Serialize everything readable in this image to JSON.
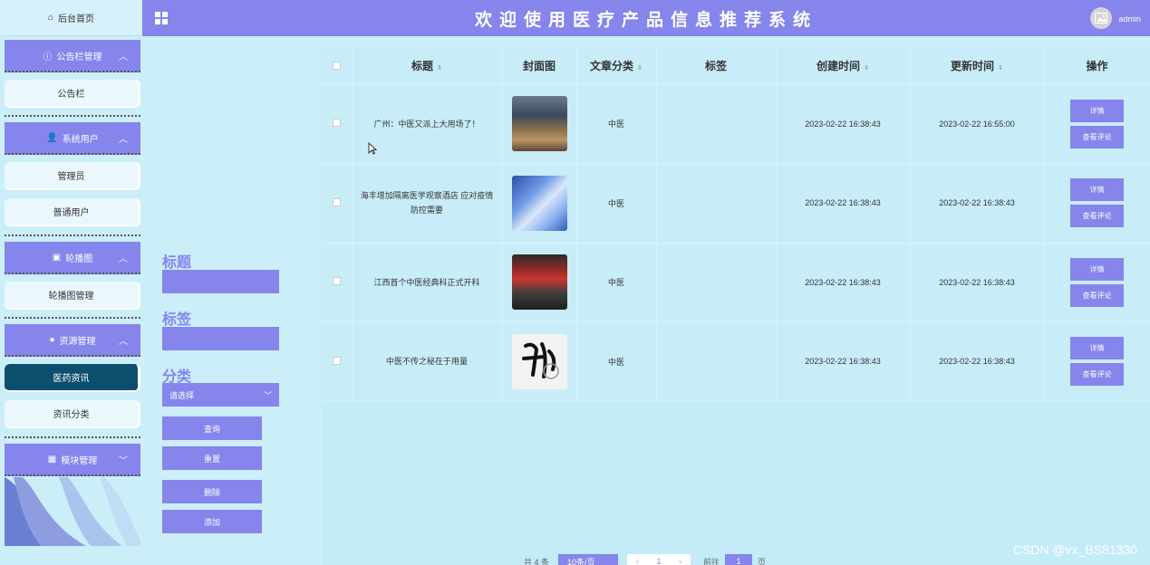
{
  "header": {
    "title": "欢迎使用医疗产品信息推荐系统",
    "user": "admin",
    "menu_toggle_icon": "grid-icon",
    "avatar_icon": "image-icon"
  },
  "sidebar": {
    "home": {
      "label": "后台首页",
      "icon": "home-icon"
    },
    "groups": [
      {
        "label": "公告栏管理",
        "icon": "info-icon",
        "items": [
          {
            "label": "公告栏"
          }
        ]
      },
      {
        "label": "系统用户",
        "icon": "user-icon",
        "items": [
          {
            "label": "管理员"
          },
          {
            "label": "普通用户"
          }
        ]
      },
      {
        "label": "轮播图",
        "icon": "picture-icon",
        "items": [
          {
            "label": "轮播图管理"
          }
        ]
      },
      {
        "label": "资源管理",
        "icon": "bulb-icon",
        "items": [
          {
            "label": "医药资讯",
            "active": true
          },
          {
            "label": "资讯分类"
          }
        ]
      },
      {
        "label": "模块管理",
        "icon": "grid-icon",
        "items": []
      }
    ]
  },
  "search": {
    "title_label": "标题",
    "tag_label": "标签",
    "category_label": "分类",
    "category_select": "请选择",
    "buttons": {
      "query": "查询",
      "reset": "重置",
      "delete": "删除",
      "add": "添加"
    }
  },
  "table": {
    "columns": {
      "title": "标题",
      "cover": "封面图",
      "category": "文章分类",
      "tag": "标签",
      "created": "创建时间",
      "updated": "更新时间",
      "actions": "操作"
    },
    "detail_label": "详情",
    "comments_label": "查看评论",
    "rows": [
      {
        "title": "广州：中医又派上大用场了！",
        "category": "中医",
        "tag": "",
        "created": "2023-02-22 16:38:43",
        "updated": "2023-02-22 16:55:00"
      },
      {
        "title": "海丰增加隔离医学观察酒店 应对疫情防控需要",
        "category": "中医",
        "tag": "",
        "created": "2023-02-22 16:38:43",
        "updated": "2023-02-22 16:38:43"
      },
      {
        "title": "江西首个中医经典科正式开科",
        "category": "中医",
        "tag": "",
        "created": "2023-02-22 16:38:43",
        "updated": "2023-02-22 16:38:43"
      },
      {
        "title": "中医不传之秘在于用量",
        "category": "中医",
        "tag": "",
        "created": "2023-02-22 16:38:43",
        "updated": "2023-02-22 16:38:43"
      }
    ]
  },
  "pagination": {
    "total": "共 4 条",
    "page_size": "10条/页",
    "current_page": "1",
    "goto_label": "前往",
    "goto_value": "1",
    "page_unit": "页"
  },
  "watermark": "CSDN @vx_BS81330"
}
